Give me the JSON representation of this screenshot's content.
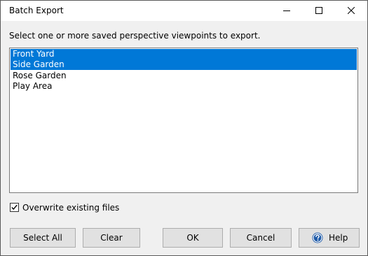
{
  "window": {
    "title": "Batch Export",
    "controls": {
      "minimize_icon": "minimize-icon",
      "maximize_icon": "maximize-icon",
      "close_icon": "close-icon"
    }
  },
  "instruction": "Select one or more saved perspective viewpoints to export.",
  "viewpoints": {
    "items": [
      {
        "label": "Front Yard",
        "selected": true
      },
      {
        "label": "Side Garden",
        "selected": true
      },
      {
        "label": "Rose Garden",
        "selected": false
      },
      {
        "label": "Play Area",
        "selected": false
      }
    ]
  },
  "overwrite": {
    "label": "Overwrite existing files",
    "checked": true
  },
  "buttons": {
    "select_all": "Select All",
    "clear": "Clear",
    "ok": "OK",
    "cancel": "Cancel",
    "help": "Help",
    "help_icon": "question-mark-circle-icon"
  },
  "colors": {
    "selection": "#0078d7",
    "help_icon_fill": "#1e5aa8"
  }
}
